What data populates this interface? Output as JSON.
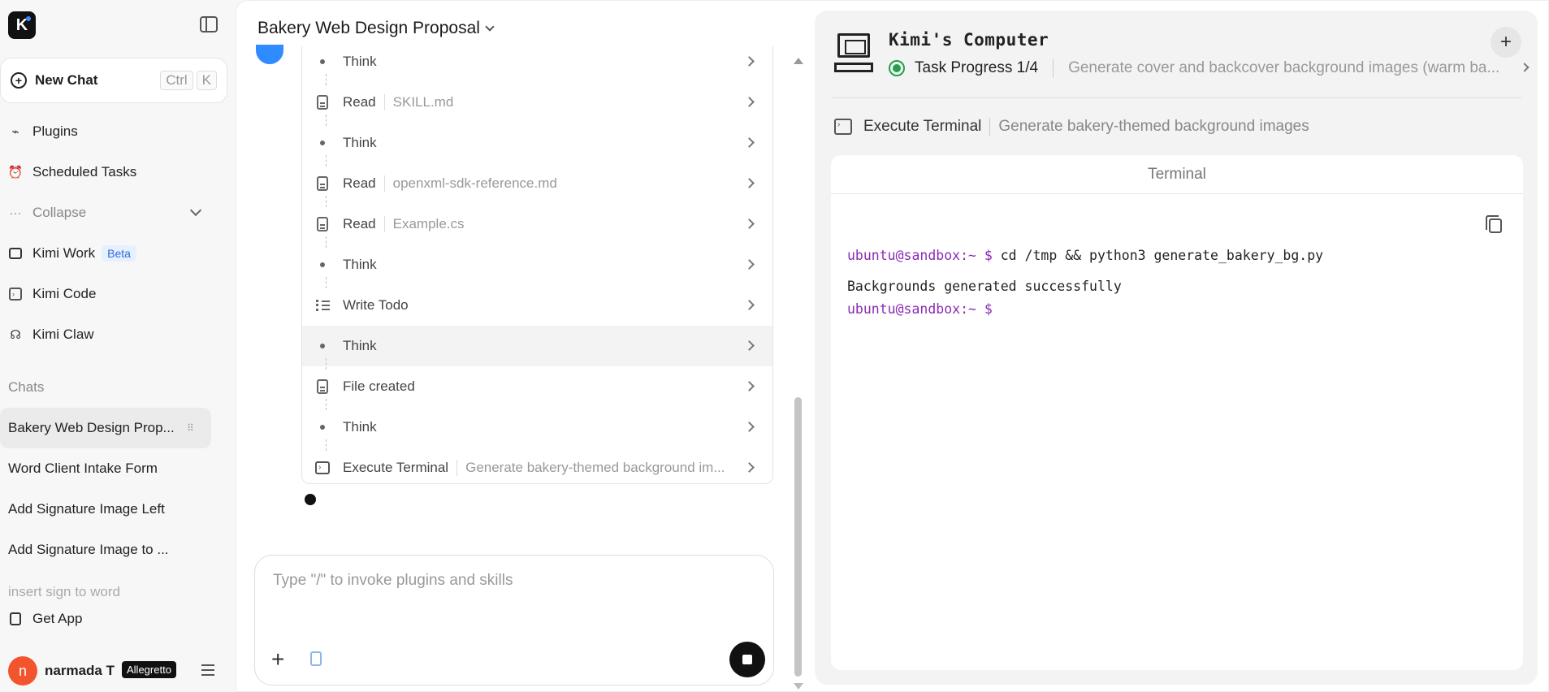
{
  "sidebar": {
    "logo_text": "K",
    "new_chat": {
      "label": "New Chat",
      "shortcut_keys": [
        "Ctrl",
        "K"
      ]
    },
    "nav": [
      {
        "label": "Plugins",
        "icon": "plug-icon"
      },
      {
        "label": "Scheduled Tasks",
        "icon": "alarm-clock-icon"
      },
      {
        "label": "Collapse",
        "icon": "ellipsis-icon"
      },
      {
        "label": "Kimi Work",
        "icon": "monitor-icon",
        "badge": "Beta"
      },
      {
        "label": "Kimi Code",
        "icon": "terminal-icon"
      },
      {
        "label": "Kimi Claw",
        "icon": "claw-icon"
      }
    ],
    "chats_label": "Chats",
    "chats": [
      "Bakery Web Design Prop...",
      "Word Client Intake Form",
      "Add Signature Image Left",
      "Add Signature Image to ...",
      "insert sign to word"
    ],
    "get_app": "Get App",
    "user": {
      "initial": "n",
      "name": "narmada T",
      "plan": "Allegretto"
    }
  },
  "main": {
    "title": "Bakery Web Design Proposal",
    "steps": [
      {
        "label": "Think",
        "icon": "bullet",
        "detail": ""
      },
      {
        "label": "Read",
        "icon": "doc",
        "detail": "SKILL.md"
      },
      {
        "label": "Think",
        "icon": "bullet",
        "detail": ""
      },
      {
        "label": "Read",
        "icon": "doc",
        "detail": "openxml-sdk-reference.md"
      },
      {
        "label": "Read",
        "icon": "doc",
        "detail": "Example.cs"
      },
      {
        "label": "Think",
        "icon": "bullet",
        "detail": ""
      },
      {
        "label": "Write Todo",
        "icon": "todo",
        "detail": ""
      },
      {
        "label": "Think",
        "icon": "bullet",
        "detail": ""
      },
      {
        "label": "File created",
        "icon": "doc",
        "detail": ""
      },
      {
        "label": "Think",
        "icon": "bullet",
        "detail": ""
      },
      {
        "label": "Execute Terminal",
        "icon": "terminal",
        "detail": "Generate bakery-themed background im..."
      }
    ],
    "input_placeholder": "Type \"/\" to invoke plugins and skills"
  },
  "computer": {
    "title": "Kimi's Computer",
    "progress_label": "Task Progress 1/4",
    "progress_desc": "Generate cover and backcover background images (warm ba...",
    "exec_label": "Execute Terminal",
    "exec_detail": "Generate bakery-themed background images",
    "terminal_title": "Terminal",
    "terminal_lines": {
      "l1_prompt": "ubuntu@sandbox:~ $",
      "l1_cmd": " cd /tmp && python3 generate_bakery_bg.py",
      "l2": "Backgrounds generated successfully",
      "l3_prompt": "ubuntu@sandbox:~ $"
    }
  },
  "colors": {
    "accent_blue": "#2f8bff",
    "prompt_purple": "#8a2bb5",
    "status_green": "#22a04b",
    "avatar_orange": "#f2542d"
  }
}
